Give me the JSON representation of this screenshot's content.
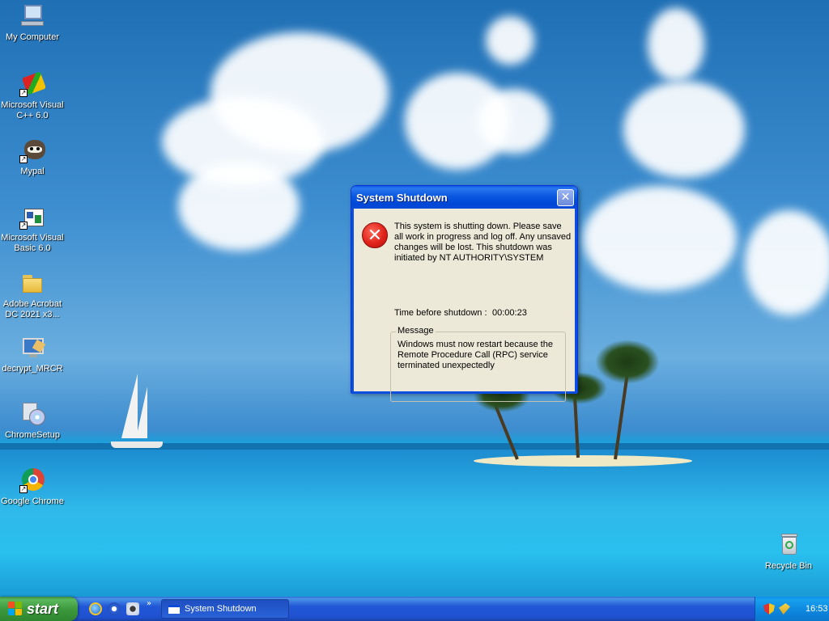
{
  "desktop": {
    "icons": [
      {
        "label": "My Computer",
        "icon": "my-computer-icon"
      },
      {
        "label": "Microsoft Visual C++ 6.0",
        "icon": "visual-cpp-icon"
      },
      {
        "label": "Mypal",
        "icon": "mypal-browser-icon"
      },
      {
        "label": "Microsoft Visual Basic 6.0",
        "icon": "visual-basic-icon"
      },
      {
        "label": "Adobe Acrobat DC 2021 x3...",
        "icon": "folder-icon"
      },
      {
        "label": "decrypt_MRCR",
        "icon": "program-icon"
      },
      {
        "label": "ChromeSetup",
        "icon": "setup-icon"
      },
      {
        "label": "Google Chrome",
        "icon": "chrome-icon"
      },
      {
        "label": "Recycle Bin",
        "icon": "recycle-bin-icon"
      }
    ]
  },
  "dialog": {
    "title": "System Shutdown",
    "close_symbol": "✕",
    "error_symbol": "✕",
    "message": "This system is shutting down. Please save all work in progress and log off. Any unsaved changes will be lost. This shutdown was initiated by NT AUTHORITY\\SYSTEM",
    "timer_label": "Time before shutdown :",
    "timer_value": "00:00:23",
    "group_label": "Message",
    "group_text": "Windows must now restart because the Remote Procedure Call (RPC) service terminated unexpectedly"
  },
  "taskbar": {
    "start_label": "start",
    "quick_launch": [
      "internet-explorer-icon",
      "media-player-icon",
      "show-desktop-icon"
    ],
    "more_symbol": "»",
    "task_label": "System Shutdown",
    "tray_icons": [
      "security-shield-icon",
      "network-icon"
    ],
    "clock": "16:53"
  },
  "colors": {
    "titlebar": "#0a58e0",
    "dialog_bg": "#ece9d8",
    "start_green": "#3e9a3e",
    "taskbar_blue": "#2157d7",
    "tray_blue": "#0d85de",
    "error_red": "#e0231a"
  }
}
